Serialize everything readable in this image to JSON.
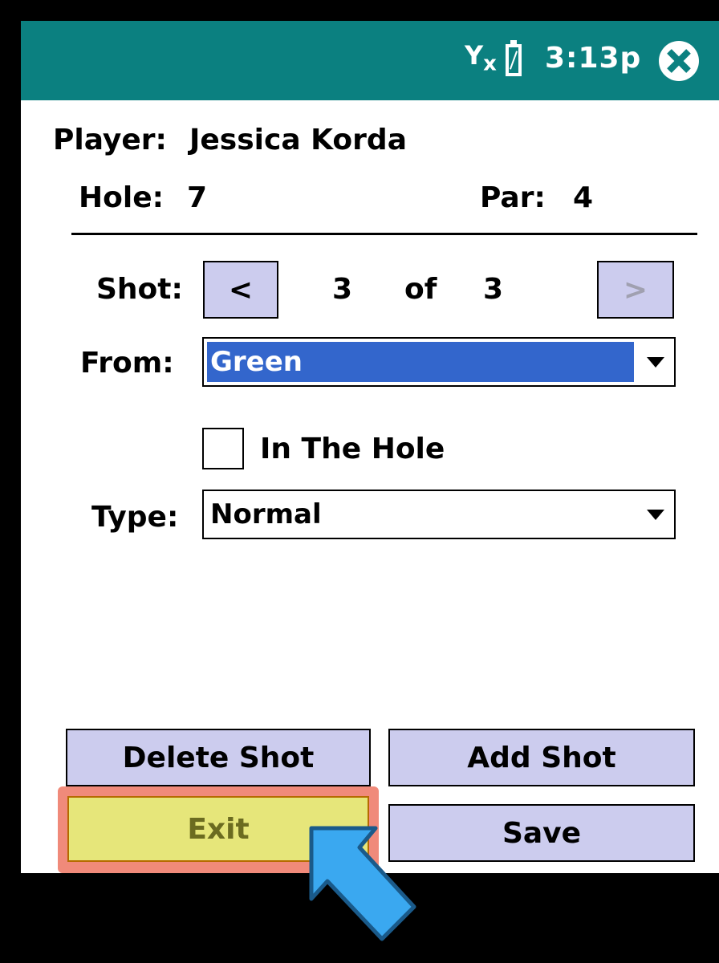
{
  "status_bar": {
    "signal_icon": "signal-off-icon",
    "battery_icon": "battery-icon",
    "time": "3:13p",
    "close_icon": "close-icon"
  },
  "player": {
    "label": "Player:",
    "name": "Jessica Korda"
  },
  "hole": {
    "label": "Hole:",
    "value": "7"
  },
  "par": {
    "label": "Par:",
    "value": "4"
  },
  "shot": {
    "label": "Shot:",
    "prev": "<",
    "current": "3",
    "of": "of",
    "total": "3",
    "next": ">"
  },
  "from": {
    "label": "From:",
    "value": "Green"
  },
  "in_the_hole": {
    "label": "In The Hole",
    "checked": false
  },
  "type": {
    "label": "Type:",
    "value": "Normal"
  },
  "buttons": {
    "delete_shot": "Delete Shot",
    "add_shot": "Add Shot",
    "exit": "Exit",
    "save": "Save"
  },
  "colors": {
    "titlebar": "#0b8080",
    "button": "#ccccee",
    "selection": "#3366cc",
    "exit_highlight": "#e6e67a",
    "pointer": "#3aa8f0"
  },
  "pointer_icon": "arrow-pointer-icon"
}
